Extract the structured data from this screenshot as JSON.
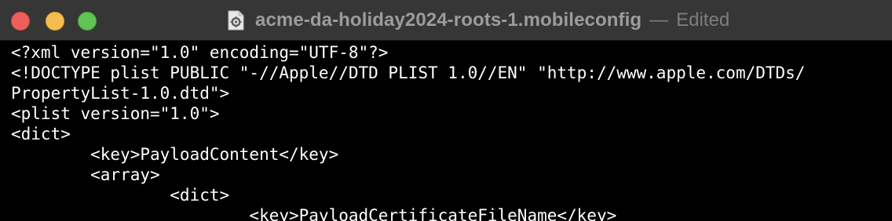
{
  "window": {
    "title": "acme-da-holiday2024-roots-1.mobileconfig",
    "separator": "—",
    "status": "Edited",
    "colors": {
      "titlebar": "#363636",
      "close": "#ec5f5a",
      "minimize": "#f3be4f",
      "zoom": "#5fc454",
      "editor_background": "#000000",
      "text": "#ffffff"
    }
  },
  "icons": {
    "close": "close-button",
    "minimize": "minimize-button",
    "zoom": "zoom-button",
    "document": "mobileconfig-document-icon"
  },
  "editor": {
    "lines": [
      "<?xml version=\"1.0\" encoding=\"UTF-8\"?>",
      "<!DOCTYPE plist PUBLIC \"-//Apple//DTD PLIST 1.0//EN\" \"http://www.apple.com/DTDs/",
      "PropertyList-1.0.dtd\">",
      "<plist version=\"1.0\">",
      "<dict>",
      "        <key>PayloadContent</key>",
      "        <array>",
      "                <dict>",
      "                        <key>PayloadCertificateFileName</key>"
    ]
  }
}
